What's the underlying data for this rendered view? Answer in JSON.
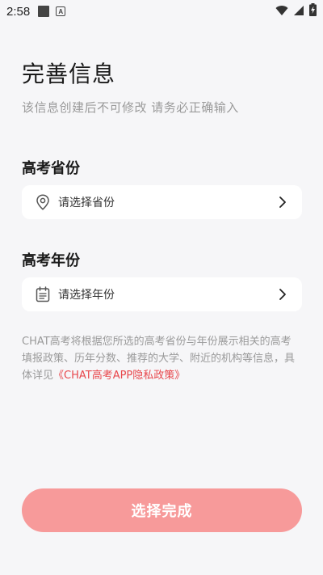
{
  "status_bar": {
    "time": "2:58",
    "notification_letter": "A"
  },
  "page": {
    "title": "完善信息",
    "subtitle": "该信息创建后不可修改 请务必正确输入"
  },
  "province_section": {
    "label": "高考省份",
    "placeholder": "请选择省份",
    "icon": "location-pin-icon"
  },
  "year_section": {
    "label": "高考年份",
    "placeholder": "请选择年份",
    "icon": "calendar-icon"
  },
  "info": {
    "text": "CHAT高考将根据您所选的高考省份与年份展示相关的高考 填报政策、历年分数、推荐的大学、附近的机构等信息，具体详见",
    "policy_link": "《CHAT高考APP隐私政策》"
  },
  "confirm_button": {
    "label": "选择完成"
  },
  "colors": {
    "accent": "#e8474c",
    "button_bg": "#f79a9a",
    "background": "#f6f6f8"
  }
}
